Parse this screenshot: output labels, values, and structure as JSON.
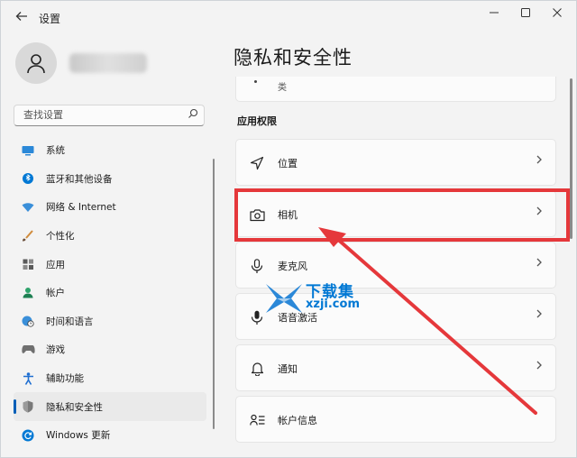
{
  "window": {
    "title": "设置"
  },
  "search": {
    "placeholder": "查找设置"
  },
  "sidebar": {
    "items": [
      {
        "label": "系统",
        "icon": "monitor-icon"
      },
      {
        "label": "蓝牙和其他设备",
        "icon": "bluetooth-icon"
      },
      {
        "label": "网络 & Internet",
        "icon": "wifi-icon"
      },
      {
        "label": "个性化",
        "icon": "brush-icon"
      },
      {
        "label": "应用",
        "icon": "apps-icon"
      },
      {
        "label": "帐户",
        "icon": "person-icon"
      },
      {
        "label": "时间和语言",
        "icon": "globe-clock-icon"
      },
      {
        "label": "游戏",
        "icon": "gamepad-icon"
      },
      {
        "label": "辅助功能",
        "icon": "accessibility-icon"
      },
      {
        "label": "隐私和安全性",
        "icon": "shield-icon",
        "active": true
      },
      {
        "label": "Windows 更新",
        "icon": "update-icon"
      }
    ]
  },
  "main": {
    "page_title": "隐私和安全性",
    "previous_card_text": "类",
    "section_title": "应用权限",
    "rows": [
      {
        "label": "位置",
        "icon": "location-icon"
      },
      {
        "label": "相机",
        "icon": "camera-icon"
      },
      {
        "label": "麦克风",
        "icon": "microphone-icon"
      },
      {
        "label": "语音激活",
        "icon": "voice-microphone-icon"
      },
      {
        "label": "通知",
        "icon": "bell-icon"
      },
      {
        "label": "帐户信息",
        "icon": "account-info-icon"
      }
    ]
  },
  "annotation": {
    "highlight_color": "#e5383b",
    "highlighted_row": "相机"
  },
  "watermark": {
    "title": "下载集",
    "domain": "xzji.com",
    "color": "#0078d4"
  },
  "colors": {
    "accent": "#005fb8"
  }
}
